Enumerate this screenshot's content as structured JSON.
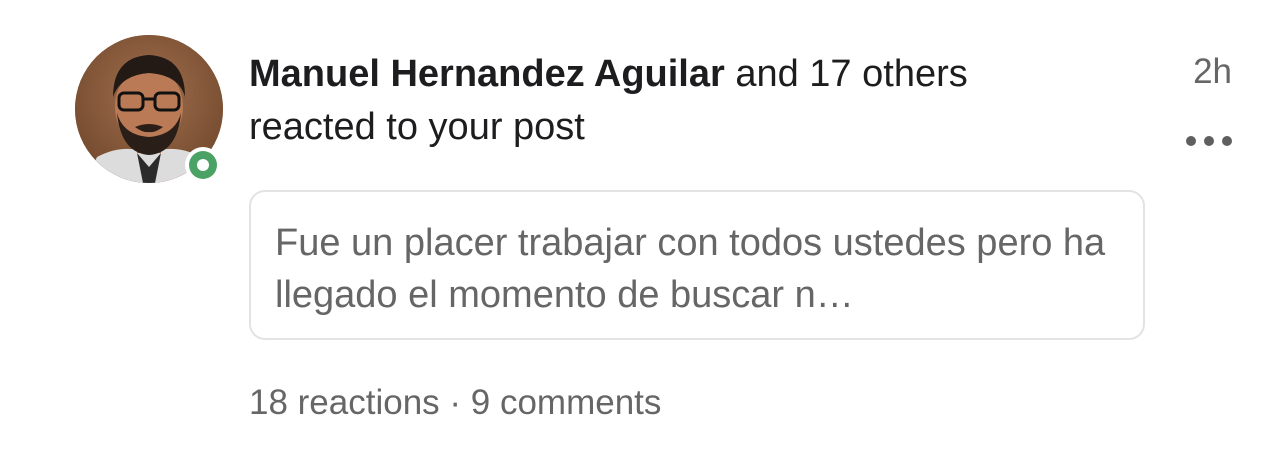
{
  "notification": {
    "actor_name": "Manuel Hernandez Aguilar",
    "actor_suffix": " and 17 others",
    "action": "reacted to your post",
    "timestamp": "2h",
    "presence_color": "#4ba265",
    "post_preview": "Fue un placer trabajar con todos ustedes pero ha llegado el momento de buscar n…",
    "stats": {
      "reactions": "18 reactions",
      "separator": " · ",
      "comments": "9 comments"
    }
  }
}
